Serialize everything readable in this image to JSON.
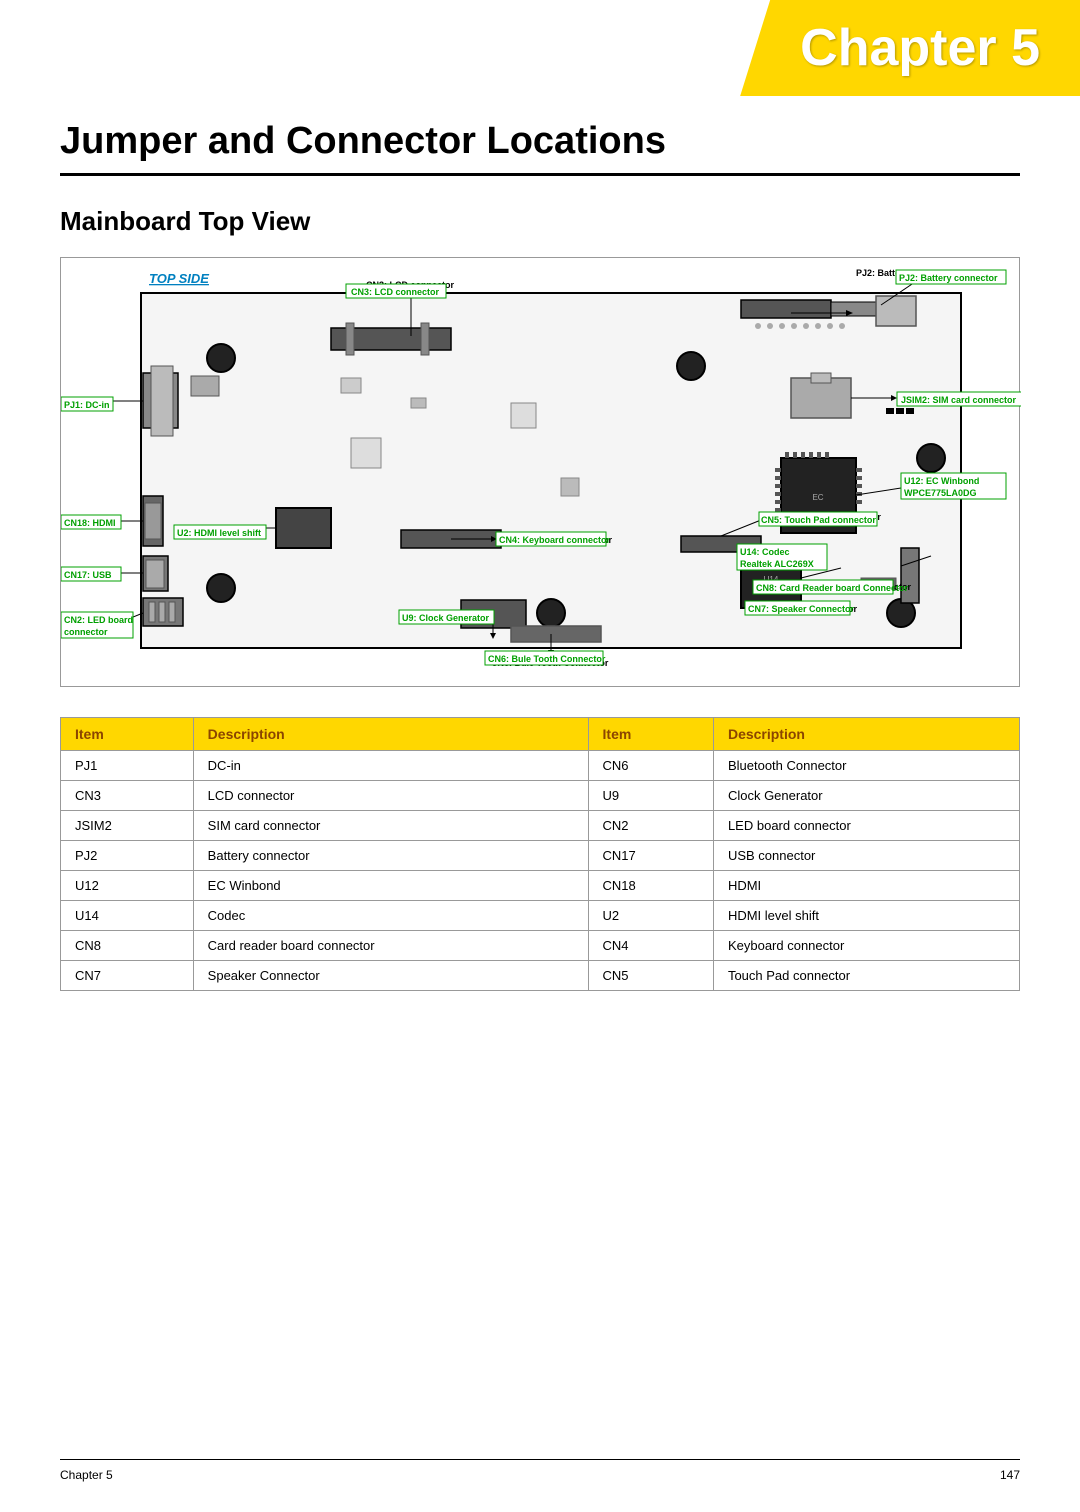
{
  "header": {
    "chapter_label": "Chapter 5",
    "chapter_word": "Chapter",
    "chapter_num": "5"
  },
  "page": {
    "main_title": "Jumper and Connector Locations",
    "section_title": "Mainboard Top View",
    "top_side_label": "TOP SIDE"
  },
  "diagram": {
    "labels": [
      {
        "id": "pj2",
        "text": "PJ2: Battery connector"
      },
      {
        "id": "cn3",
        "text": "CN3: LCD connector"
      },
      {
        "id": "pj1",
        "text": "PJ1: DC-in"
      },
      {
        "id": "jsim2",
        "text": "JSIM2: SIM card connector"
      },
      {
        "id": "u12",
        "text": "U12: EC Winbond"
      },
      {
        "id": "u12b",
        "text": "WPCE775LA0DG"
      },
      {
        "id": "cn4",
        "text": "CN4: Keyboard connector"
      },
      {
        "id": "cn5",
        "text": "CN5: Touch Pad connector"
      },
      {
        "id": "cn18",
        "text": "CN18: HDMI"
      },
      {
        "id": "u2",
        "text": "U2: HDMI level shift"
      },
      {
        "id": "u14",
        "text": "U14: Codec"
      },
      {
        "id": "u14b",
        "text": "Realtek ALC269X"
      },
      {
        "id": "cn17",
        "text": "CN17: USB"
      },
      {
        "id": "cn8",
        "text": "CN8: Card Reader board Connector"
      },
      {
        "id": "cn7",
        "text": "CN7: Speaker Connector"
      },
      {
        "id": "u9",
        "text": "U9: Clock Generator"
      },
      {
        "id": "cn6",
        "text": "CN6: Bule Tooth Connector"
      },
      {
        "id": "cn2",
        "text": "CN2: LED board"
      },
      {
        "id": "cn2b",
        "text": "connector"
      }
    ]
  },
  "table": {
    "headers": [
      "Item",
      "Description",
      "Item",
      "Description"
    ],
    "rows": [
      {
        "item1": "PJ1",
        "desc1": "DC-in",
        "item2": "CN6",
        "desc2": "Bluetooth Connector"
      },
      {
        "item1": "CN3",
        "desc1": "LCD connector",
        "item2": "U9",
        "desc2": "Clock Generator"
      },
      {
        "item1": "JSIM2",
        "desc1": "SIM card connector",
        "item2": "CN2",
        "desc2": "LED board connector"
      },
      {
        "item1": "PJ2",
        "desc1": "Battery connector",
        "item2": "CN17",
        "desc2": "USB connector"
      },
      {
        "item1": "U12",
        "desc1": "EC Winbond",
        "item2": "CN18",
        "desc2": "HDMI"
      },
      {
        "item1": "U14",
        "desc1": "Codec",
        "item2": "U2",
        "desc2": "HDMI level shift"
      },
      {
        "item1": "CN8",
        "desc1": "Card reader board connector",
        "item2": "CN4",
        "desc2": "Keyboard connector"
      },
      {
        "item1": "CN7",
        "desc1": "Speaker Connector",
        "item2": "CN5",
        "desc2": "Touch Pad connector"
      }
    ]
  },
  "footer": {
    "left": "Chapter 5",
    "right": "147"
  }
}
